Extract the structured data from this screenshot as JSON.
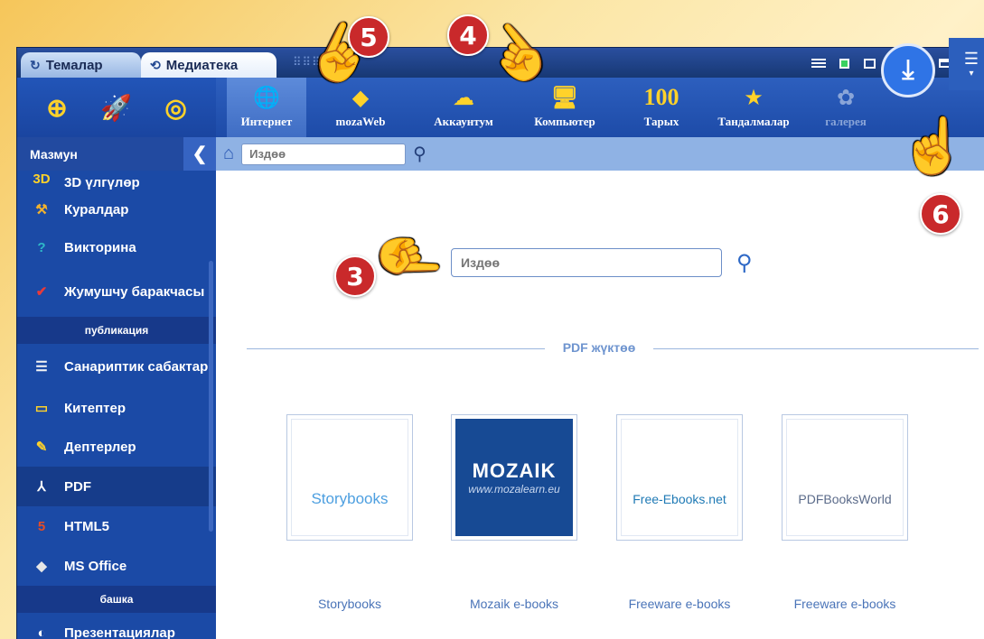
{
  "window": {
    "tabs": [
      {
        "label": "Темалар",
        "icon": "refresh-icon"
      },
      {
        "label": "Медиатека",
        "icon": "media-icon"
      }
    ],
    "controls": [
      "layout-icon",
      "green-square-icon",
      "window-icon",
      "help-icon",
      "restore-icon",
      "maximize-icon",
      "close-icon"
    ],
    "help_glyph": "?",
    "close_glyph": "✕"
  },
  "sidebar": {
    "header": "Мазмун",
    "collapse_glyph": "❮",
    "items": [
      {
        "label": "3D үлгүлөр",
        "icon": "3d-icon",
        "glyph": "3D",
        "color": "#ffd22a"
      },
      {
        "label": "Куралдар",
        "icon": "hammer-icon",
        "glyph": "⚒",
        "color": "#f2b22d"
      },
      {
        "label": "Викторина",
        "icon": "quiz-icon",
        "glyph": "?",
        "color": "#2fb9c8"
      },
      {
        "label": "Жумушчу баракчасы",
        "icon": "worksheet-icon",
        "glyph": "✔",
        "color": "#e83a3a"
      },
      {
        "section": "публикация"
      },
      {
        "label": "Санариптик сабактар",
        "icon": "digital-lesson-icon",
        "glyph": "☰",
        "color": "#f4f4f4"
      },
      {
        "label": "Китептер",
        "icon": "book-icon",
        "glyph": "▭",
        "color": "#ffd22a"
      },
      {
        "label": "Дептерлер",
        "icon": "notebook-icon",
        "glyph": "✎",
        "color": "#ffd22a"
      },
      {
        "label": "PDF",
        "icon": "pdf-icon",
        "glyph": "⅄",
        "color": "#ffffff",
        "active": true
      },
      {
        "label": "HTML5",
        "icon": "html5-icon",
        "glyph": "5",
        "color": "#e44d26"
      },
      {
        "label": "MS Office",
        "icon": "ms-office-icon",
        "glyph": "◆",
        "color": "#e6e6e6"
      },
      {
        "section": "башка"
      },
      {
        "label": "Презентациялар",
        "icon": "presentation-icon",
        "glyph": "◐",
        "color": "#ffffff"
      }
    ]
  },
  "toolbar": {
    "left_tools": [
      "add-icon",
      "rocket-icon",
      "target-icon"
    ],
    "buttons": [
      {
        "label": "Интернет",
        "icon": "internet-icon",
        "glyph": "🌐",
        "selected": true
      },
      {
        "label": "mozaWeb",
        "icon": "mozaweb-icon",
        "glyph": "◆"
      },
      {
        "label": "Аккаунтум",
        "icon": "account-icon",
        "glyph": "☁"
      },
      {
        "label": "Компьютер",
        "icon": "computer-icon",
        "glyph": "🖥"
      },
      {
        "label": "Тарых",
        "icon": "history-icon",
        "glyph": "100"
      },
      {
        "label": "Тандалмалар",
        "icon": "favorites-icon",
        "glyph": "★"
      },
      {
        "label": "галерея",
        "icon": "gallery-icon",
        "glyph": "✿",
        "dim": true
      }
    ],
    "download_glyph": "⤓",
    "more_glyph": "☰"
  },
  "searchbar": {
    "placeholder": "Издөө"
  },
  "content": {
    "search_placeholder": "Издөө",
    "section_title": "PDF жүктөө",
    "tiles": [
      {
        "logo": "Storybooks",
        "caption": "Storybooks",
        "logo_color": "#4d9fe0"
      },
      {
        "logo": "MOZAIK",
        "logo_sub": "www.mozalearn.eu",
        "caption": "Mozaik e-books"
      },
      {
        "logo": "Free-Ebooks.net",
        "caption": "Freeware e-books",
        "logo_color": "#1f7ab5"
      },
      {
        "logo": "PDFBooksWorld",
        "caption": "Freeware e-books",
        "logo_color": "#5b6b8a"
      }
    ]
  },
  "callouts": [
    "3",
    "4",
    "5",
    "6"
  ]
}
